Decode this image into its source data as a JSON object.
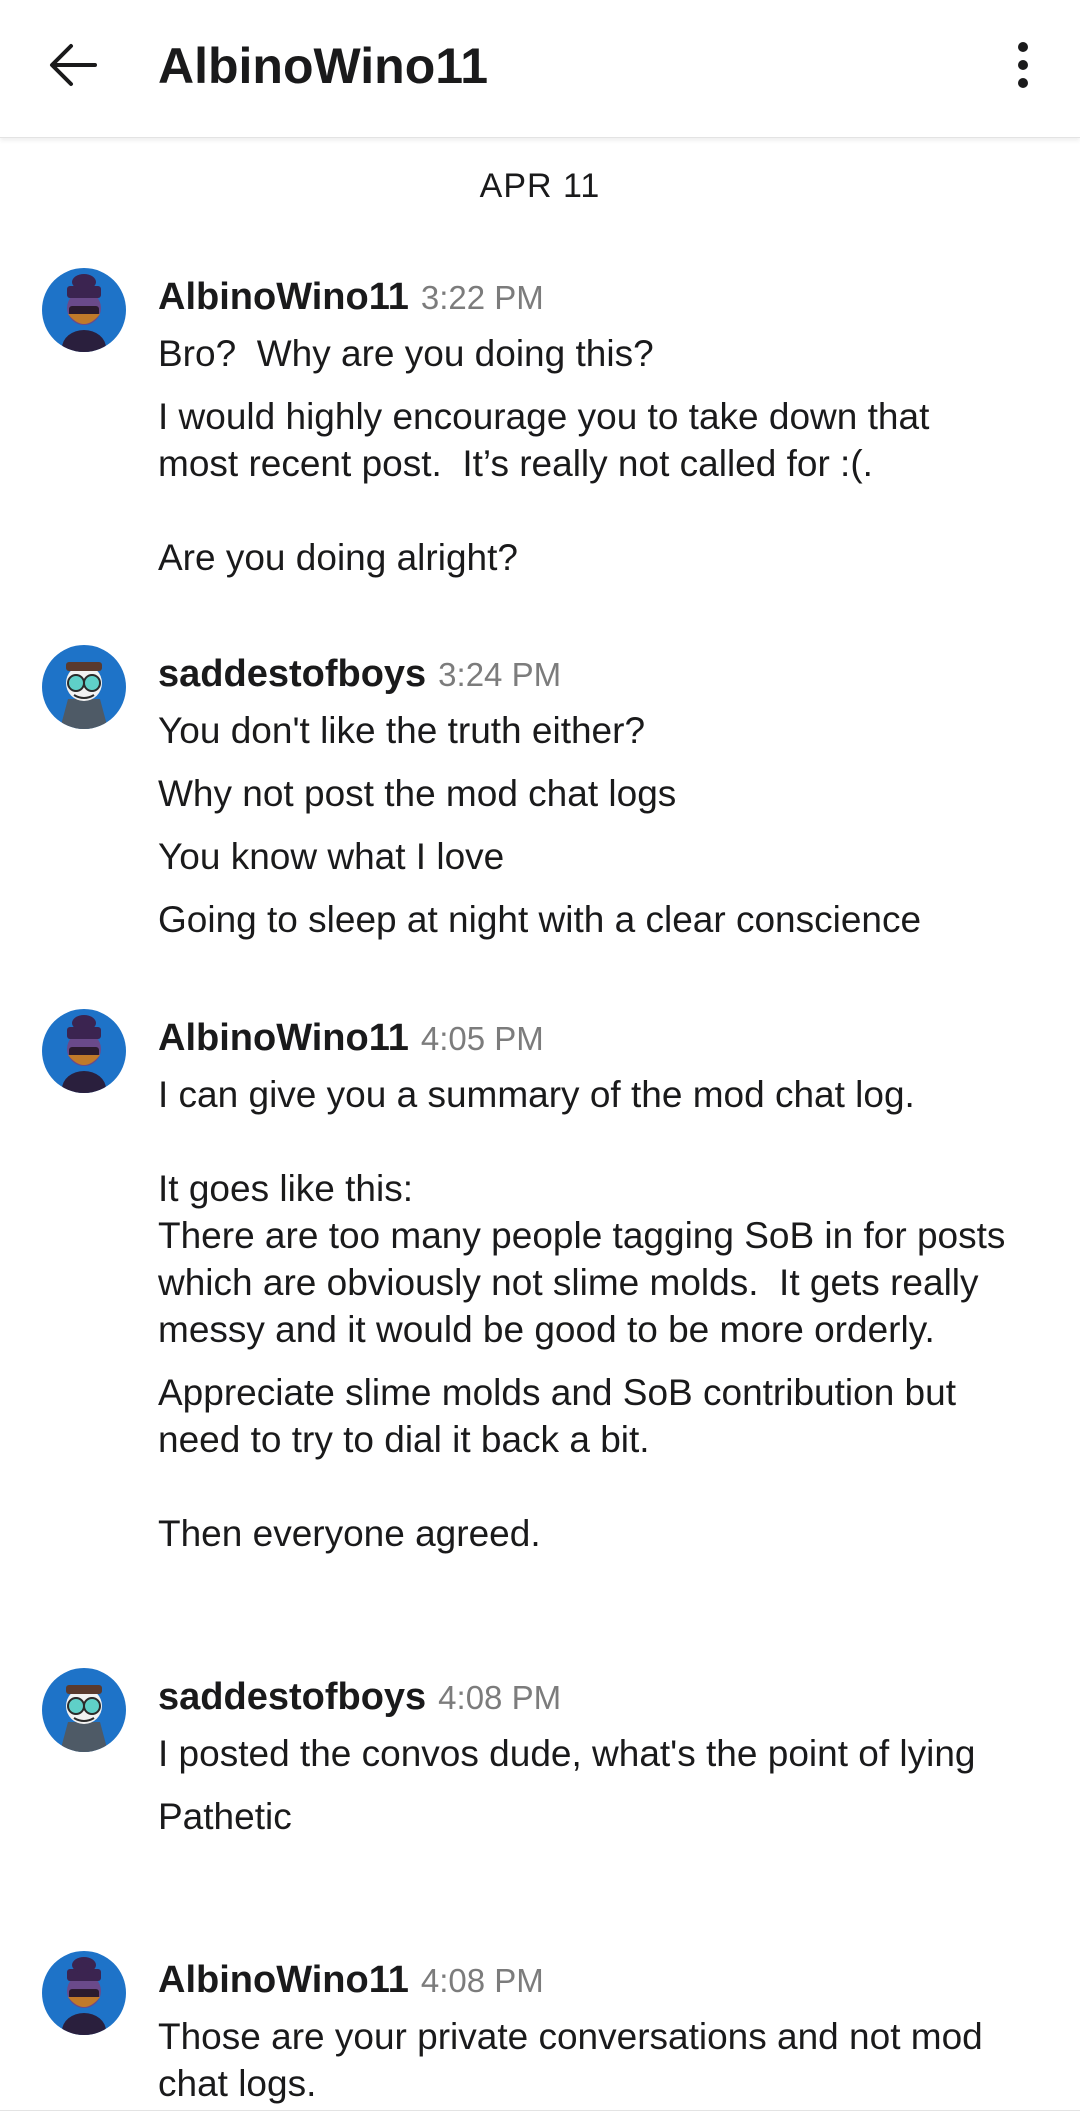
{
  "header": {
    "title": "AlbinoWino11",
    "back_icon": "arrow-left-icon",
    "more_icon": "more-vertical-icon"
  },
  "date_separator": "APR 11",
  "colors": {
    "avatar_bg": "#1e73c8",
    "text": "#1a1a1b",
    "timestamp": "#7c7c7c"
  },
  "groups": [
    {
      "author": "AlbinoWino11",
      "time": "3:22 PM",
      "avatar": "avatar-hat-figure",
      "messages": [
        "Bro?  Why are you doing this?",
        "I would highly encourage you to take down that most recent post.  It’s really not called for :(.\n\nAre you doing alright?"
      ]
    },
    {
      "author": "saddestofboys",
      "time": "3:24 PM",
      "avatar": "avatar-goggles-figure",
      "messages": [
        "You don't like the truth either?",
        "Why not post the mod chat logs",
        "You know what I love",
        "Going to sleep at night with a clear conscience"
      ]
    },
    {
      "author": "AlbinoWino11",
      "time": "4:05 PM",
      "avatar": "avatar-hat-figure",
      "messages": [
        "I can give you a summary of the mod chat log.\n\nIt goes like this:\nThere are too many people tagging SoB in for posts which are obviously not slime molds.  It gets really messy and it would be good to be more orderly.",
        "Appreciate slime molds and SoB contribution but need to try to dial it back a bit.\n\nThen everyone agreed."
      ]
    },
    {
      "author": "saddestofboys",
      "time": "4:08 PM",
      "avatar": "avatar-goggles-figure",
      "messages": [
        "I posted the convos dude, what's the point of lying",
        "Pathetic"
      ]
    },
    {
      "author": "AlbinoWino11",
      "time": "4:08 PM",
      "avatar": "avatar-hat-figure",
      "messages": [
        "Those are your private conversations and not mod chat logs."
      ]
    }
  ]
}
